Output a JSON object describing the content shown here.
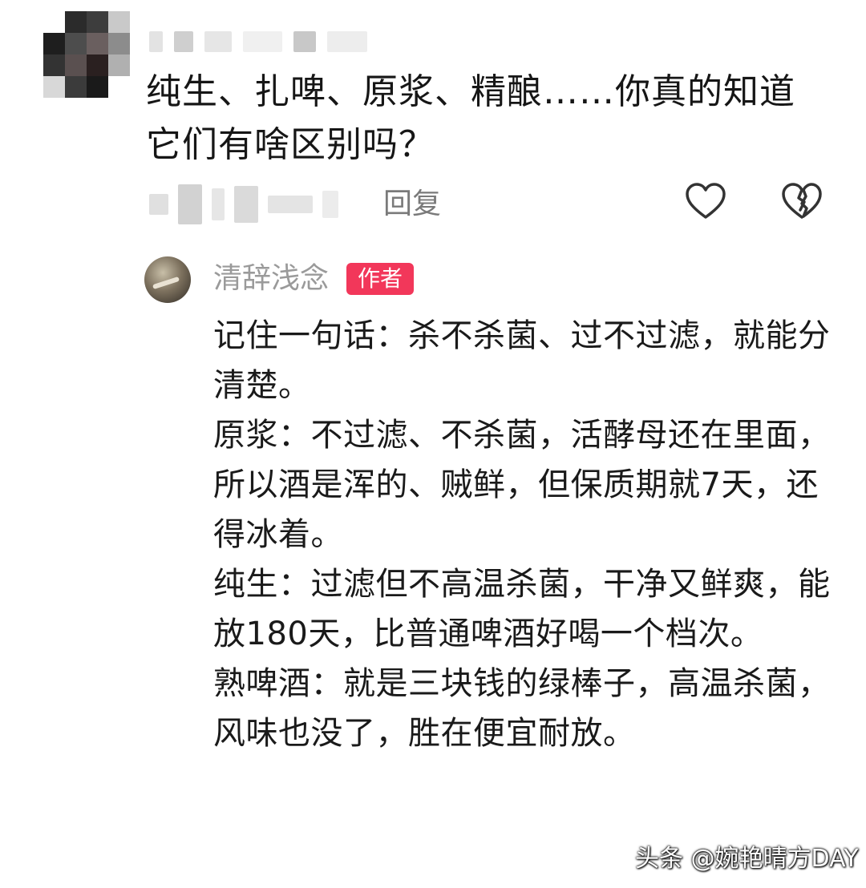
{
  "comment": {
    "text": "纯生、扎啤、原浆、精酿……你真的知道它们有啥区别吗？",
    "reply_label": "回复",
    "meta_tail": "前",
    "icons": {
      "like": "heart-outline-icon",
      "dislike": "broken-heart-icon"
    }
  },
  "author_reply": {
    "name": "清辞浅念",
    "badge": "作者",
    "paragraphs": [
      "记住一句话：杀不杀菌、过不过滤，就能分清楚。",
      "原浆：不过滤、不杀菌，活酵母还在里面，所以酒是浑的、贼鲜，但保质期就7天，还得冰着。",
      "纯生：过滤但不高温杀菌，干净又鲜爽，能放180天，比普通啤酒好喝一个档次。",
      "熟啤酒：就是三块钱的绿棒子，高温杀菌，风味也没了，胜在便宜耐放。"
    ],
    "badge_color": "#f2375a"
  },
  "watermark": {
    "text": "头条 @婉艳晴方DAY"
  }
}
